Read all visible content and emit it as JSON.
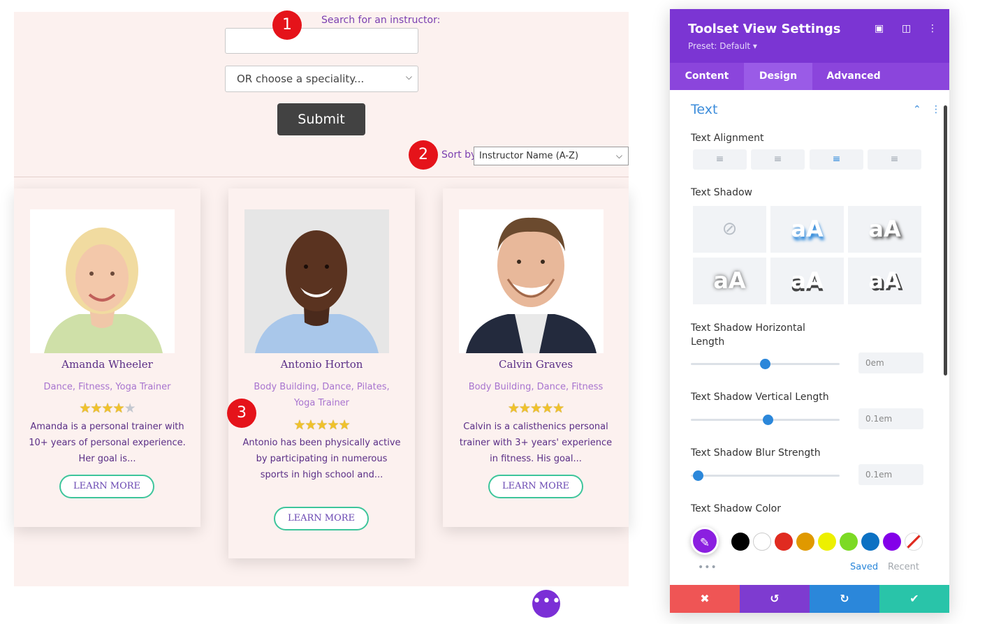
{
  "form": {
    "search_label": "Search for an instructor:",
    "speciality_value": "OR choose a speciality...",
    "submit_label": "Submit",
    "sort_label": "Sort by",
    "sort_value": "Instructor Name (A-Z)"
  },
  "badges": [
    "1",
    "2",
    "3"
  ],
  "cards": [
    {
      "name": "Amanda Wheeler",
      "specialities": "Dance, Fitness, Yoga Trainer",
      "rating": 4,
      "description": "Amanda is a personal trainer with 10+ years of personal experience. Her goal is...",
      "button": "LEARN MORE"
    },
    {
      "name": "Antonio Horton",
      "specialities": "Body Building, Dance, Pilates, Yoga Trainer",
      "rating": 5,
      "description": "Antonio has been physically active by participating in numerous sports in high school and...",
      "button": "LEARN MORE"
    },
    {
      "name": "Calvin Graves",
      "specialities": "Body Building, Dance, Fitness",
      "rating": 5,
      "description": "Calvin is a calisthenics personal trainer with 3+ years' experience in fitness. His goal...",
      "button": "LEARN MORE"
    }
  ],
  "panel": {
    "title": "Toolset View Settings",
    "preset": "Preset: Default ▾",
    "tabs": [
      {
        "label": "Content",
        "active": false
      },
      {
        "label": "Design",
        "active": true
      },
      {
        "label": "Advanced",
        "active": false
      }
    ],
    "section_title": "Text",
    "text_alignment_label": "Text Alignment",
    "text_alignment_active": "right",
    "text_shadow_label": "Text Shadow",
    "shadow_preview_text": "aA",
    "sliders": [
      {
        "label": "Text Shadow Horizontal Length",
        "value": "0em",
        "fraction": 0.5
      },
      {
        "label": "Text Shadow Vertical Length",
        "value": "0.1em",
        "fraction": 0.52
      },
      {
        "label": "Text Shadow Blur Strength",
        "value": "0.1em",
        "fraction": 0.05
      }
    ],
    "shadow_color_label": "Text Shadow Color",
    "swatches": [
      "#000000",
      "#ffffff",
      "#e02b20",
      "#e09900",
      "#edf000",
      "#7cda24",
      "#0c71c3",
      "#8300e9"
    ],
    "saved_label": "Saved",
    "recent_label": "Recent",
    "footer": {
      "cancel_color": "#ef5555",
      "undo_color": "#7e3bd0",
      "redo_color": "#2b87da",
      "save_color": "#29c4a9"
    }
  }
}
